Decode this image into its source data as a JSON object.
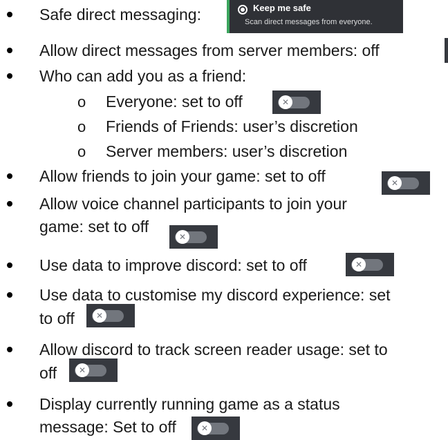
{
  "items": [
    {
      "text": "Safe direct messaging:"
    },
    {
      "text": "Allow direct messages from server members:  off"
    },
    {
      "text": "Who can add you as a friend:"
    },
    {
      "text": "Allow friends to join your game: set to off"
    },
    {
      "text": "Allow voice channel participants to join your"
    },
    {
      "text": "game: set to off"
    },
    {
      "text": "Use data to improve discord: set to off"
    },
    {
      "text": "Use data to customise my discord experience: set"
    },
    {
      "text": "to off"
    },
    {
      "text": "Allow discord to track screen reader usage: set to"
    },
    {
      "text": "off"
    },
    {
      "text": "Display currently running game as a status"
    },
    {
      "text": "message: Set to off"
    }
  ],
  "sub_items": [
    {
      "marker": "o",
      "text": "Everyone: set to off"
    },
    {
      "marker": "o",
      "text": "Friends of Friends: user’s discretion"
    },
    {
      "marker": "o",
      "text": "Server members: user’s discretion"
    }
  ],
  "safe_dm_option": {
    "title": "Keep me safe",
    "description": "Scan direct messages from everyone."
  },
  "toggles": {
    "state": "off",
    "icon": "x-icon"
  },
  "colors": {
    "toggle_bg": "#36393f",
    "toggle_track": "#72767d",
    "safe_box_bg": "#2f3136",
    "safe_box_accent": "#3ba55d"
  }
}
